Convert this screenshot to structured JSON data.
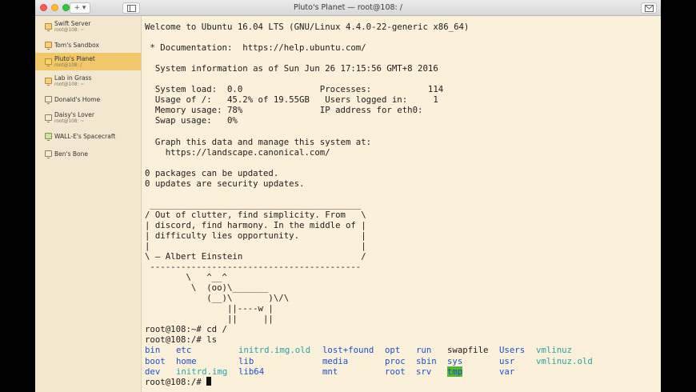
{
  "window": {
    "title": "Pluto's Planet — root@108: /",
    "add_button_label": "+ ▾"
  },
  "sidebar": {
    "items": [
      {
        "name": "Swift Server",
        "sub": "root@108: ~",
        "selected": false
      },
      {
        "name": "Tom's Sandbox",
        "sub": "",
        "selected": false
      },
      {
        "name": "Pluto's Planet",
        "sub": "root@108: /",
        "selected": true
      },
      {
        "name": "Lab in Grass",
        "sub": "root@108: ~",
        "selected": false
      },
      {
        "name": "Donald's Home",
        "sub": "",
        "selected": false
      },
      {
        "name": "Daisy's Lover",
        "sub": "root@108: ~",
        "selected": false
      },
      {
        "name": "WALL-E's Spacecraft",
        "sub": "",
        "selected": false
      },
      {
        "name": "Ben's Bone",
        "sub": "",
        "selected": false
      }
    ]
  },
  "terminal": {
    "lines": [
      "Welcome to Ubuntu 16.04 LTS (GNU/Linux 4.4.0-22-generic x86_64)",
      "",
      " * Documentation:  https://help.ubuntu.com/",
      "",
      "  System information as of Sun Jun 26 17:15:56 GMT+8 2016",
      "",
      "  System load:  0.0               Processes:           114",
      "  Usage of /:   45.2% of 19.55GB   Users logged in:     1",
      "  Memory usage: 78%               IP address for eth0:",
      "  Swap usage:   0%",
      "",
      "  Graph this data and manage this system at:",
      "    https://landscape.canonical.com/",
      "",
      "0 packages can be updated.",
      "0 updates are security updates.",
      "",
      " _________________________________________",
      "/ Out of clutter, find simplicity. From   \\",
      "| discord, find harmony. In the middle of |",
      "| difficulty lies opportunity.            |",
      "|                                         |",
      "\\ — Albert Einstein                       /",
      " -----------------------------------------",
      "        \\   ^__^",
      "         \\  (oo)\\_______",
      "            (__)\\       )\\/\\",
      "                ||----w |",
      "                ||     ||",
      "root@108:~# cd /",
      "root@108:/# ls"
    ],
    "ls_rows": [
      [
        {
          "text": "bin",
          "cls": "c-dir"
        },
        {
          "text": "etc",
          "cls": "c-dir"
        },
        {
          "text": "initrd.img.old",
          "cls": "c-cyan"
        },
        {
          "text": "lost+found",
          "cls": "c-dir"
        },
        {
          "text": "opt",
          "cls": "c-dir"
        },
        {
          "text": "run",
          "cls": "c-dir"
        },
        {
          "text": "swapfile",
          "cls": ""
        },
        {
          "text": "Users",
          "cls": "c-dir"
        },
        {
          "text": "vmlinuz",
          "cls": "c-cyan"
        }
      ],
      [
        {
          "text": "boot",
          "cls": "c-dir"
        },
        {
          "text": "home",
          "cls": "c-dir"
        },
        {
          "text": "lib",
          "cls": "c-dir"
        },
        {
          "text": "media",
          "cls": "c-dir"
        },
        {
          "text": "proc",
          "cls": "c-dir"
        },
        {
          "text": "sbin",
          "cls": "c-dir"
        },
        {
          "text": "sys",
          "cls": "c-dir"
        },
        {
          "text": "usr",
          "cls": "c-dir"
        },
        {
          "text": "vmlinuz.old",
          "cls": "c-cyan"
        }
      ],
      [
        {
          "text": "dev",
          "cls": "c-dir"
        },
        {
          "text": "initrd.img",
          "cls": "c-cyan"
        },
        {
          "text": "lib64",
          "cls": "c-dir"
        },
        {
          "text": "mnt",
          "cls": "c-dir"
        },
        {
          "text": "root",
          "cls": "c-dir"
        },
        {
          "text": "srv",
          "cls": "c-dir"
        },
        {
          "text": "tmp",
          "cls": "c-tmp"
        },
        {
          "text": "var",
          "cls": "c-dir"
        },
        {
          "text": "",
          "cls": ""
        }
      ]
    ],
    "prompt": "root@108:/# "
  }
}
